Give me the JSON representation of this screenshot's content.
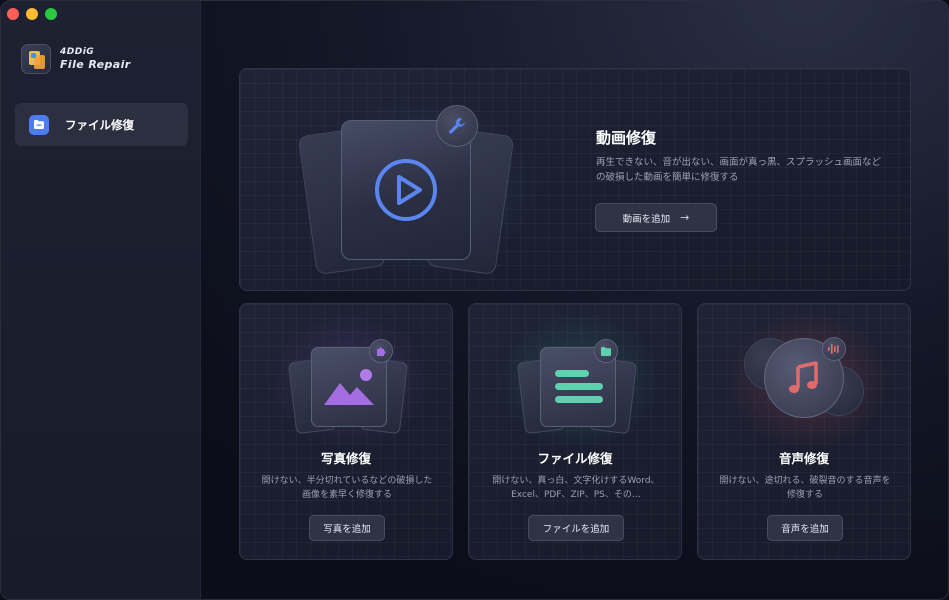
{
  "app": {
    "brand_line1": "4DDiG",
    "brand_line2": "File Repair"
  },
  "sidebar": {
    "items": [
      {
        "label": "ファイル修復",
        "icon": "folder-icon",
        "active": true
      }
    ]
  },
  "hero": {
    "title": "動画修復",
    "description": "再生できない、音が出ない、画面が真っ黒、スプラッシュ画面などの破損した動画を簡単に修復する",
    "button_label": "動画を追加",
    "button_arrow": "→"
  },
  "cards": [
    {
      "title": "写真修復",
      "description": "開けない、半分切れているなどの破損した画像を素早く修復する",
      "button_label": "写真を追加"
    },
    {
      "title": "ファイル修復",
      "description": "開けない、真っ白、文字化けするWord、Excel、PDF、ZIP、PS、その…",
      "button_label": "ファイルを追加"
    },
    {
      "title": "音声修復",
      "description": "開けない、途切れる、破裂音のする音声を修復する",
      "button_label": "音声を追加"
    }
  ],
  "colors": {
    "accent_blue": "#4f7bf0",
    "photo_purple": "#a56de2",
    "file_green": "#5fd0b0",
    "audio_red": "#e36a6a"
  }
}
